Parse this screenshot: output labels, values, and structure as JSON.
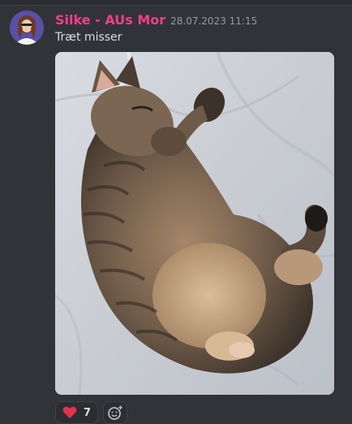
{
  "message": {
    "author": "Silke - AUs Mor",
    "timestamp": "28.07.2023 11:15",
    "text": "Træt misser",
    "author_color": "#ee3f8c"
  },
  "attachment": {
    "alt": "cat-sleeping-photo"
  },
  "reactions": [
    {
      "icon": "heart-icon",
      "count": "7",
      "color": "#e0334f"
    }
  ],
  "add_reaction": {
    "icon": "add-reaction-icon"
  }
}
